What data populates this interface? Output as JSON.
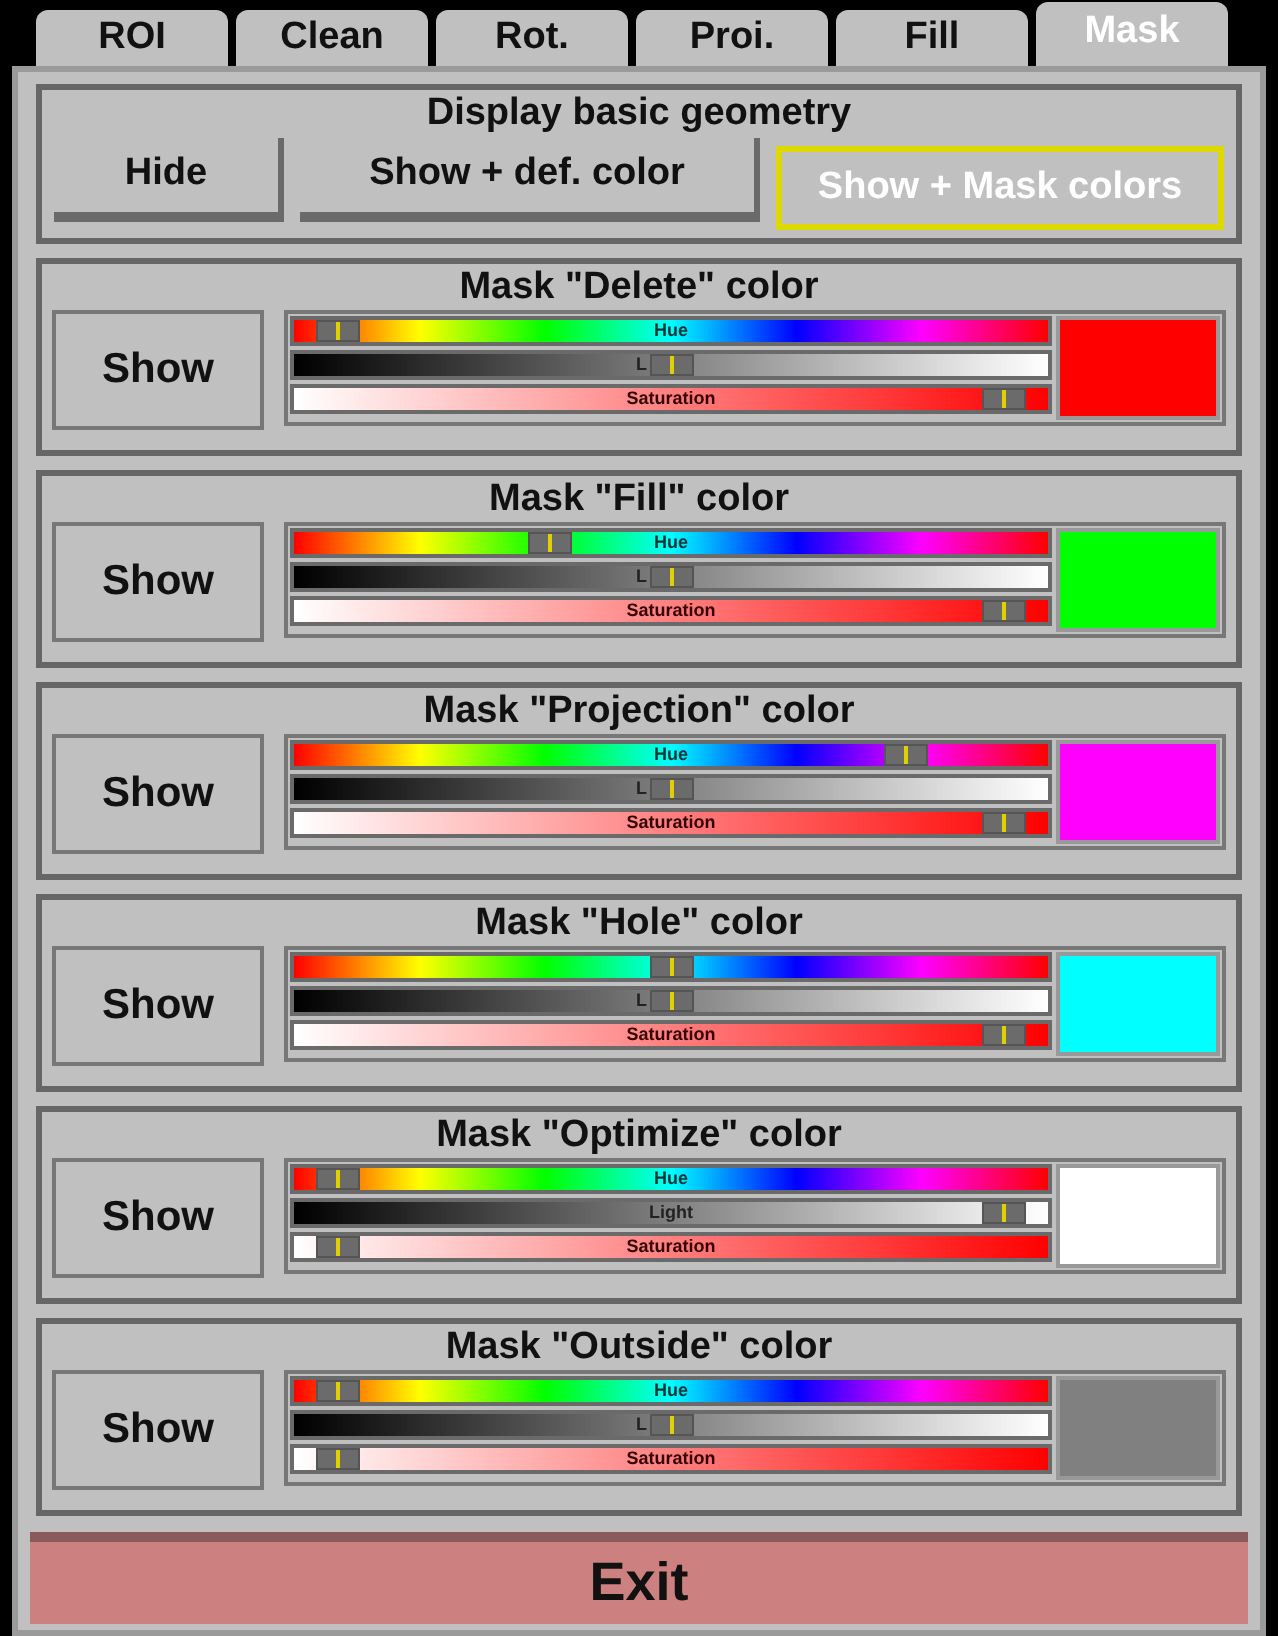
{
  "tabs": [
    {
      "label": "ROI",
      "selected": false
    },
    {
      "label": "Clean",
      "selected": false
    },
    {
      "label": "Rot.",
      "selected": false
    },
    {
      "label": "Proi.",
      "selected": false
    },
    {
      "label": "Fill",
      "selected": false
    },
    {
      "label": "Mask",
      "selected": true
    }
  ],
  "geometry": {
    "title": "Display basic geometry",
    "buttons": [
      {
        "label": "Hide",
        "selected": false
      },
      {
        "label": "Show + def. color",
        "selected": false
      },
      {
        "label": "Show + Mask colors",
        "selected": true
      }
    ]
  },
  "masks": [
    {
      "title": "Mask \"Delete\" color",
      "button": "Show",
      "color": "#ff0000",
      "sliders": [
        {
          "kind": "hue",
          "label": "Hue",
          "level": 0.03
        },
        {
          "kind": "light",
          "label": "L",
          "level": 0.5
        },
        {
          "kind": "saturation",
          "label": "Saturation",
          "level": 0.97
        }
      ]
    },
    {
      "title": "Mask \"Fill\" color",
      "button": "Show",
      "color": "#00ff00",
      "sliders": [
        {
          "kind": "hue",
          "label": "Hue",
          "level": 0.33
        },
        {
          "kind": "light",
          "label": "L",
          "level": 0.5
        },
        {
          "kind": "saturation",
          "label": "Saturation",
          "level": 0.97
        }
      ]
    },
    {
      "title": "Mask \"Projection\" color",
      "button": "Show",
      "color": "#ff00ff",
      "sliders": [
        {
          "kind": "hue",
          "label": "Hue",
          "level": 0.83
        },
        {
          "kind": "light",
          "label": "L",
          "level": 0.5
        },
        {
          "kind": "saturation",
          "label": "Saturation",
          "level": 0.97
        }
      ]
    },
    {
      "title": "Mask \"Hole\" color",
      "button": "Show",
      "color": "#00ffff",
      "sliders": [
        {
          "kind": "hue",
          "level": 0.5
        },
        {
          "kind": "light",
          "label": "L",
          "level": 0.5
        },
        {
          "kind": "saturation",
          "label": "Saturation",
          "level": 0.97
        }
      ]
    },
    {
      "title": "Mask \"Optimize\" color",
      "button": "Show",
      "color": "#ffffff",
      "sliders": [
        {
          "kind": "hue",
          "label": "Hue",
          "level": 0.03
        },
        {
          "kind": "light",
          "label": "Light",
          "level": 0.97
        },
        {
          "kind": "saturation",
          "label": "Saturation",
          "level": 0.03
        }
      ]
    },
    {
      "title": "Mask \"Outside\" color",
      "button": "Show",
      "color": "#808080",
      "sliders": [
        {
          "kind": "hue",
          "label": "Hue",
          "level": 0.03
        },
        {
          "kind": "light",
          "label": "L",
          "level": 0.5
        },
        {
          "kind": "saturation",
          "label": "Saturation",
          "level": 0.03
        }
      ]
    }
  ],
  "exit": "Exit"
}
